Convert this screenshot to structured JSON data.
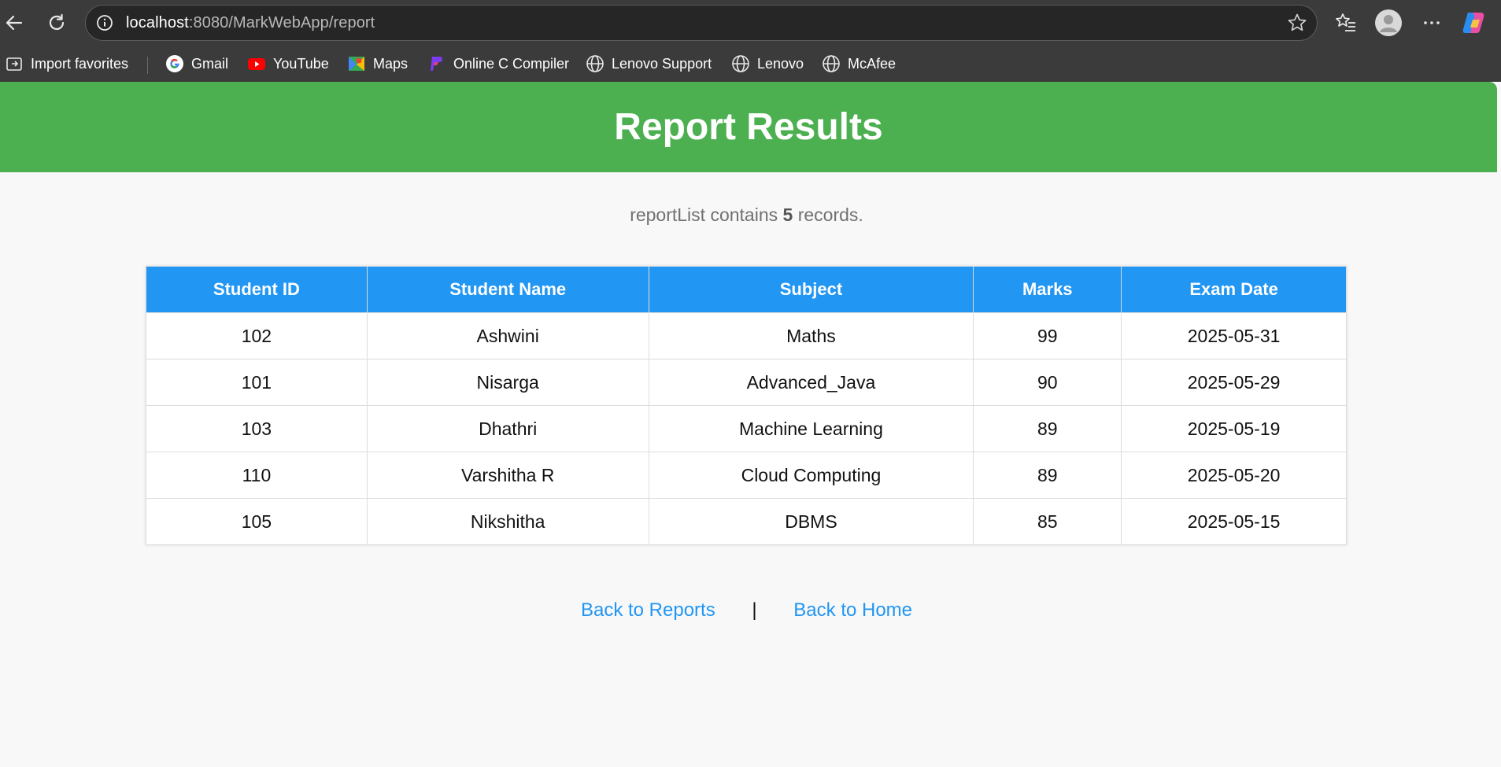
{
  "browser": {
    "url_host": "localhost",
    "url_rest": ":8080/MarkWebApp/report",
    "bookmarks": [
      {
        "label": "Import favorites",
        "icon": "import-favorites-icon"
      },
      {
        "label": "Gmail",
        "icon": "google-icon"
      },
      {
        "label": "YouTube",
        "icon": "youtube-icon"
      },
      {
        "label": "Maps",
        "icon": "maps-icon"
      },
      {
        "label": "Online C Compiler",
        "icon": "compiler-icon"
      },
      {
        "label": "Lenovo Support",
        "icon": "globe-icon"
      },
      {
        "label": "Lenovo",
        "icon": "globe-icon"
      },
      {
        "label": "McAfee",
        "icon": "globe-icon"
      }
    ]
  },
  "header": {
    "title": "Report Results",
    "color": "#4caf50"
  },
  "summary": {
    "prefix": "reportList contains",
    "count": "5",
    "suffix": "records."
  },
  "table": {
    "header_color": "#2196f3",
    "columns": [
      "Student ID",
      "Student Name",
      "Subject",
      "Marks",
      "Exam Date"
    ],
    "rows": [
      [
        "102",
        "Ashwini",
        "Maths",
        "99",
        "2025-05-31"
      ],
      [
        "101",
        "Nisarga",
        "Advanced_Java",
        "90",
        "2025-05-29"
      ],
      [
        "103",
        "Dhathri",
        "Machine Learning",
        "89",
        "2025-05-19"
      ],
      [
        "110",
        "Varshitha R",
        "Cloud Computing",
        "89",
        "2025-05-20"
      ],
      [
        "105",
        "Nikshitha",
        "DBMS",
        "85",
        "2025-05-15"
      ]
    ]
  },
  "links": {
    "back_reports": "Back to Reports",
    "separator": "|",
    "back_home": "Back to Home",
    "color": "#2196f3"
  }
}
